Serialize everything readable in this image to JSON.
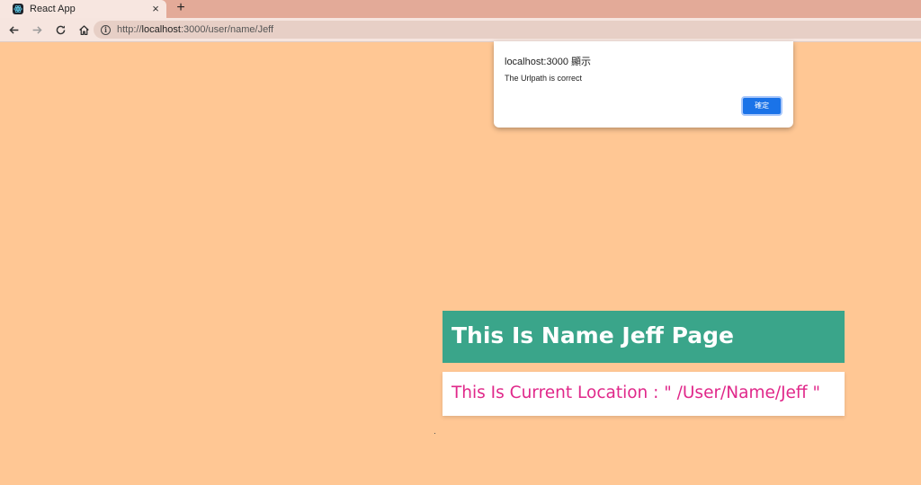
{
  "browser": {
    "tab": {
      "title": "React App",
      "close_glyph": "×",
      "favicon": "react-favicon-icon"
    },
    "new_tab_glyph": "+",
    "toolbar": {
      "back_icon": "back-arrow-icon",
      "forward_icon": "forward-arrow-icon",
      "reload_icon": "reload-icon",
      "home_icon": "home-icon"
    },
    "omnibox": {
      "info_glyph": "i",
      "url_prefix": "http://",
      "url_host": "localhost",
      "url_rest": ":3000/user/name/Jeff"
    }
  },
  "alert": {
    "title": "localhost:3000 顯示",
    "message": "The Urlpath is correct",
    "ok_label": "確定"
  },
  "page": {
    "background": "#ffc794",
    "header_text": "This Is Name Jeff Page",
    "header_bg": "#3aa58a",
    "location_text": "This Is Current Location : \" /User/Name/Jeff \"",
    "location_color": "#e0288a"
  }
}
